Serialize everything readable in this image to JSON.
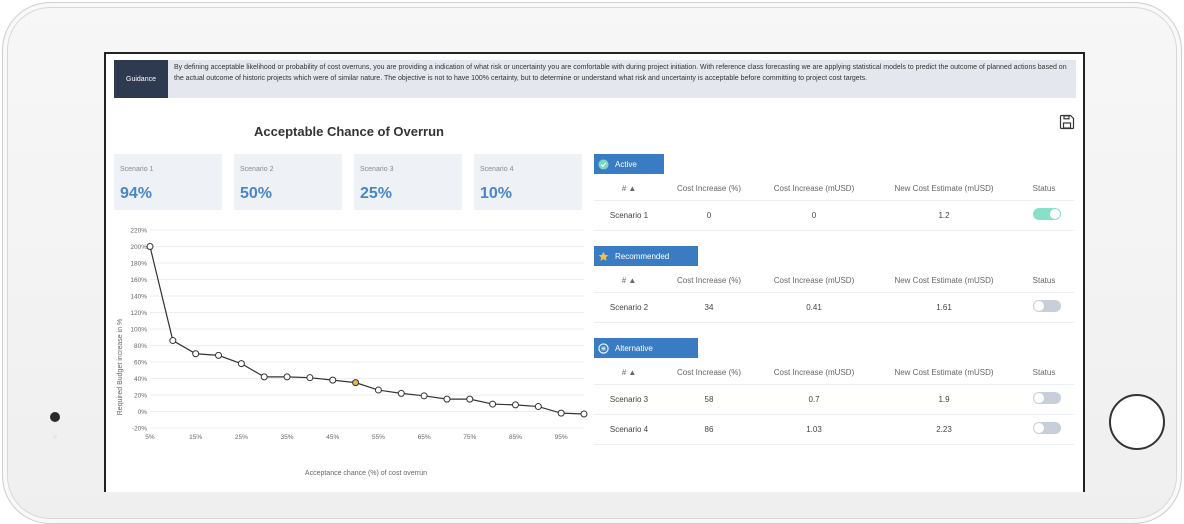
{
  "guidance": {
    "label": "Guidance",
    "text": "By defining acceptable likelihood or probability of cost overruns, you are providing a indication of what risk or uncertainty you are comfortable with during project initiation. With reference class forecasting we are applying statistical models to predict the outcome of planned actions based on the actual outcome of historic projects which were of similar nature. The objective is not to have 100% certainty, but to determine or understand what risk and uncertainty is acceptable before committing to project cost targets."
  },
  "chart_title": "Acceptable Chance of Overrun",
  "scenarios": [
    {
      "label": "Scenario 1",
      "value": "94%"
    },
    {
      "label": "Scenario 2",
      "value": "50%"
    },
    {
      "label": "Scenario 3",
      "value": "25%"
    },
    {
      "label": "Scenario 4",
      "value": "10%"
    }
  ],
  "chart_data": {
    "type": "line",
    "xlabel": "Acceptance chance (%) of cost overrun",
    "ylabel": "Required Budget increase in %",
    "x": [
      5,
      10,
      15,
      20,
      25,
      30,
      35,
      40,
      45,
      50,
      55,
      60,
      65,
      70,
      75,
      80,
      85,
      90,
      95,
      100
    ],
    "values": [
      200,
      86,
      70,
      68,
      58,
      42,
      42,
      41,
      38,
      35,
      26,
      22,
      19,
      15,
      15,
      9,
      8,
      6,
      -2,
      -3
    ],
    "highlight_x": 50,
    "x_ticks": [
      "5%",
      "15%",
      "25%",
      "35%",
      "45%",
      "55%",
      "65%",
      "75%",
      "85%",
      "95%"
    ],
    "y_ticks": [
      "-20%",
      "0%",
      "20%",
      "40%",
      "60%",
      "80%",
      "100%",
      "120%",
      "140%",
      "160%",
      "180%",
      "200%",
      "220%"
    ],
    "ylim": [
      -20,
      220
    ],
    "xlim": [
      5,
      100
    ],
    "line_color": "#333333",
    "highlight_color": "#e8b84a"
  },
  "columns": [
    "# ▲",
    "Cost Increase (%)",
    "Cost Increase (mUSD)",
    "New Cost Estimate (mUSD)",
    "Status"
  ],
  "sections": [
    {
      "title": "Active",
      "icon": "check-circle-icon",
      "rows": [
        {
          "name": "Scenario 1",
          "pct": "0",
          "musd": "0",
          "estimate": "1.2",
          "on": true
        }
      ]
    },
    {
      "title": "Recommended",
      "icon": "star-icon",
      "rows": [
        {
          "name": "Scenario 2",
          "pct": "34",
          "musd": "0.41",
          "estimate": "1.61",
          "on": false
        }
      ]
    },
    {
      "title": "Alternative",
      "icon": "list-circle-icon",
      "rows": [
        {
          "name": "Scenario 3",
          "pct": "58",
          "musd": "0.7",
          "estimate": "1.9",
          "on": false
        },
        {
          "name": "Scenario 4",
          "pct": "86",
          "musd": "1.03",
          "estimate": "2.23",
          "on": false
        }
      ]
    }
  ],
  "colors": {
    "accent": "#3a7cc4",
    "value_blue": "#4a86c8",
    "toggle_on": "#88e0c8"
  }
}
